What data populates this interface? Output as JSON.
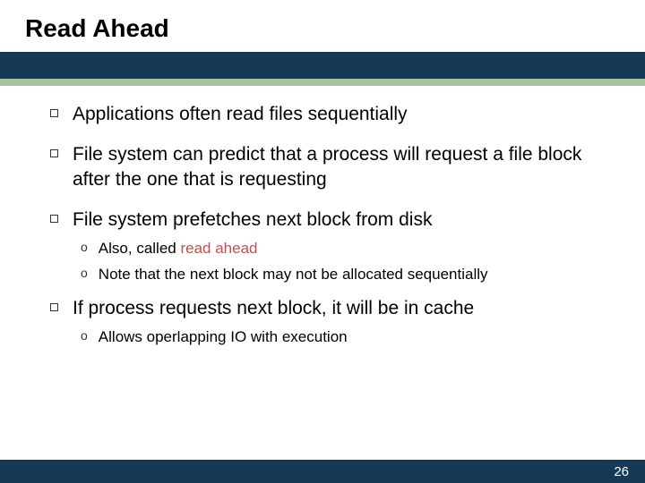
{
  "title": "Read Ahead",
  "bullets": {
    "b1": "Applications often read files sequentially",
    "b2": "File system can predict that a process will request a file block after the one that is requesting",
    "b3": "File system prefetches next block from disk",
    "b3a_prefix": "Also, called ",
    "b3a_highlight": "read ahead",
    "b3b": "Note that the next block may not be allocated sequentially",
    "b4": "If process requests next block, it will be in cache",
    "b4a": "Allows operlapping IO with execution"
  },
  "page_number": "26"
}
